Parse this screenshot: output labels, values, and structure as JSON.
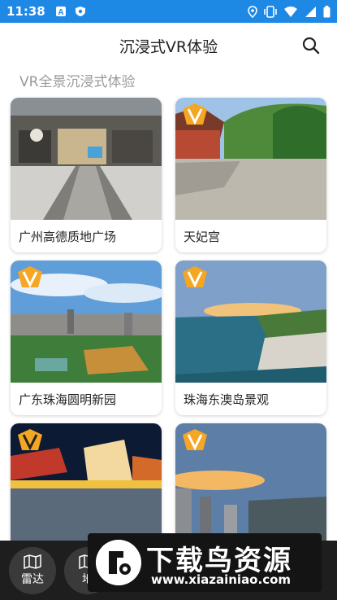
{
  "status_bar": {
    "time": "11:38"
  },
  "header": {
    "title": "沉浸式VR体验"
  },
  "section": {
    "title": "VR全景沉浸式体验"
  },
  "cards": [
    {
      "label": "广州高德质地广场",
      "vip": false
    },
    {
      "label": "天妃宫",
      "vip": true
    },
    {
      "label": "广东珠海圆明新园",
      "vip": true
    },
    {
      "label": "珠海东澳岛景观",
      "vip": true
    },
    {
      "label": "",
      "vip": true
    },
    {
      "label": "",
      "vip": true
    }
  ],
  "badge": {
    "letter": "V",
    "color": "#f5a623"
  },
  "bottom_nav": {
    "items": [
      {
        "label": "雷达"
      },
      {
        "label": "地"
      }
    ]
  },
  "watermark": {
    "title": "下载鸟资源",
    "url": "www.xiazainiao.com"
  },
  "colors": {
    "status_bar": "#1e88e5",
    "nav_bg": "#1e1e1e"
  }
}
